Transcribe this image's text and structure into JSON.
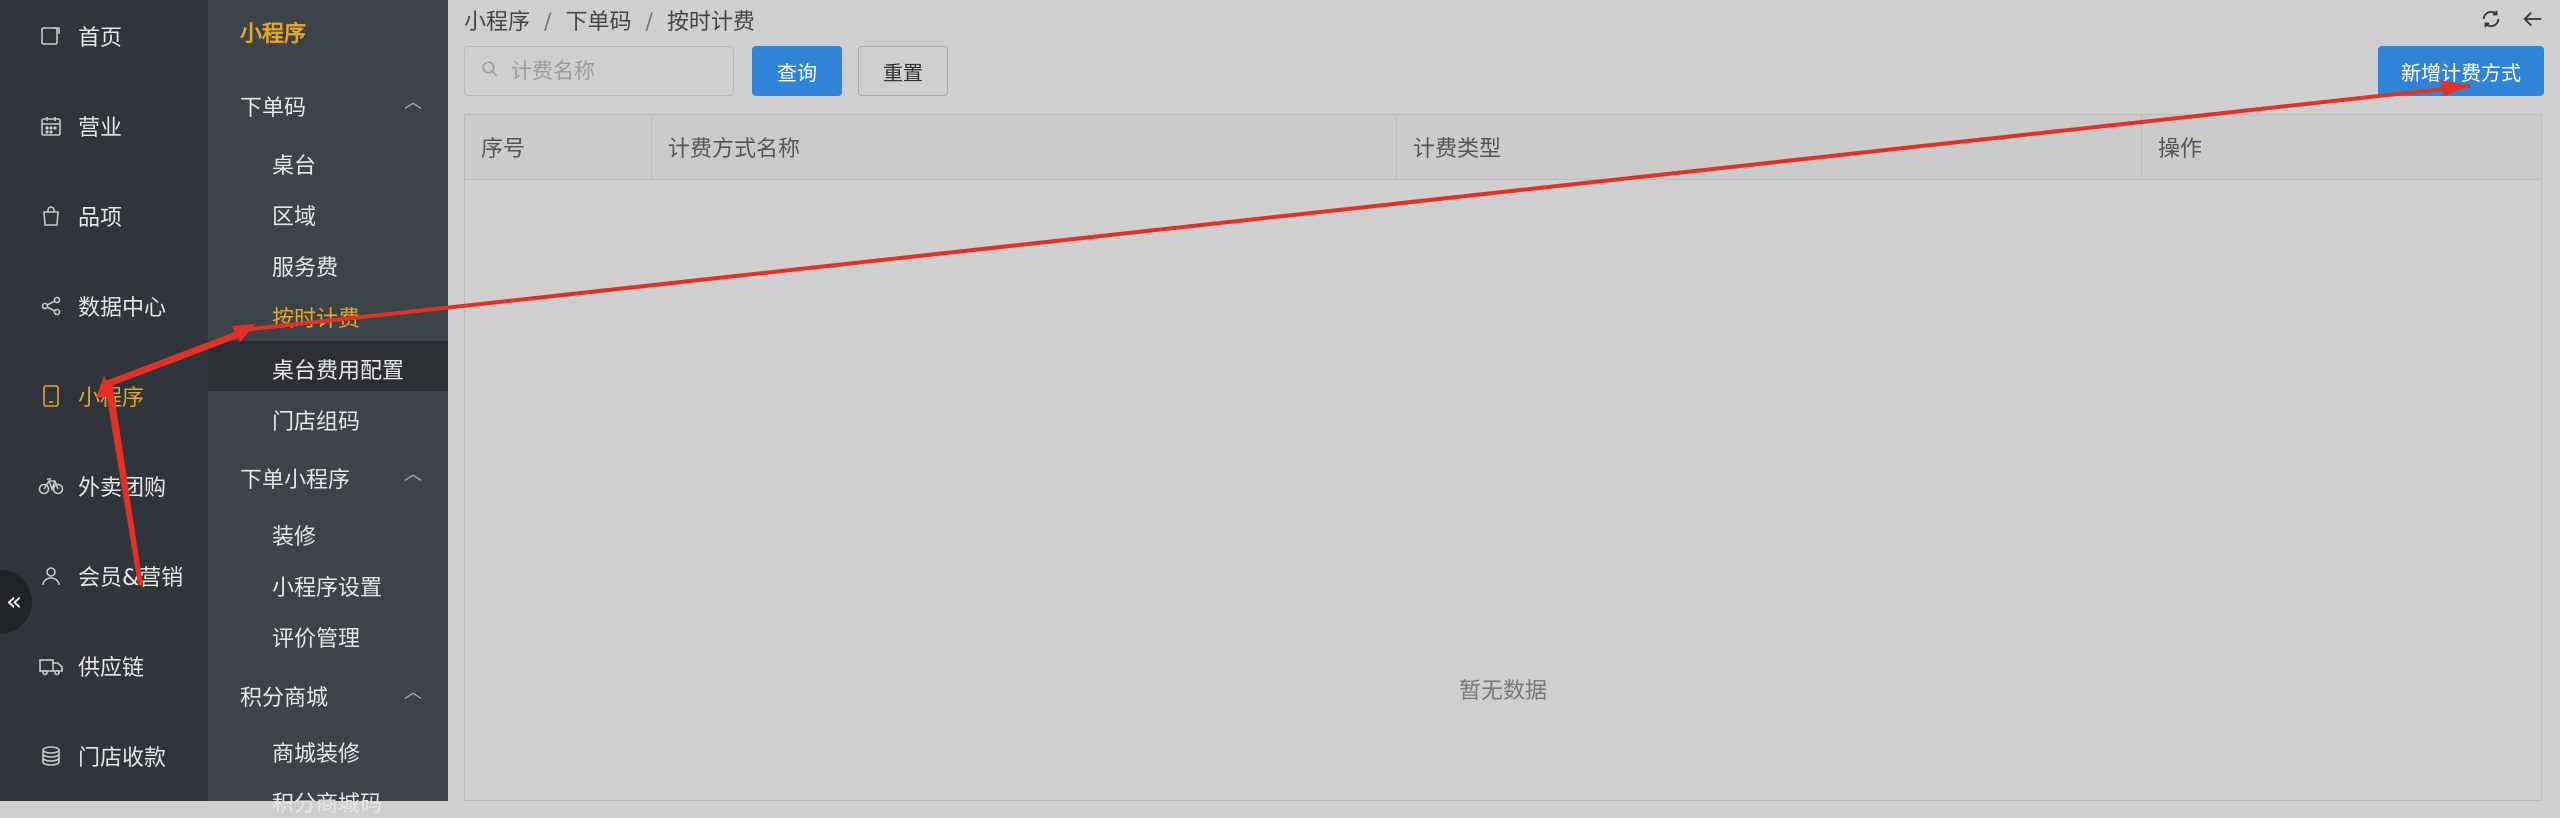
{
  "sidebar": {
    "items": [
      {
        "label": "首页",
        "icon": "home-icon"
      },
      {
        "label": "营业",
        "icon": "calendar-icon"
      },
      {
        "label": "品项",
        "icon": "shopping-bag-icon"
      },
      {
        "label": "数据中心",
        "icon": "share-icon"
      },
      {
        "label": "小程序",
        "icon": "tablet-icon",
        "active": true
      },
      {
        "label": "外卖团购",
        "icon": "bicycle-icon"
      },
      {
        "label": "会员&营销",
        "icon": "user-icon"
      },
      {
        "label": "供应链",
        "icon": "truck-icon"
      },
      {
        "label": "门店收款",
        "icon": "coins-icon"
      }
    ],
    "collapse_icon": "double-chevron-left-icon"
  },
  "subnav": {
    "title": "小程序",
    "groups": [
      {
        "label": "下单码",
        "items": [
          "桌台",
          "区域",
          "服务费",
          "按时计费",
          "桌台费用配置",
          "门店组码"
        ]
      },
      {
        "label": "下单小程序",
        "items": [
          "装修",
          "小程序设置",
          "评价管理"
        ]
      },
      {
        "label": "积分商城",
        "items": [
          "商城装修",
          "积分商城码"
        ]
      }
    ],
    "active_item": "按时计费"
  },
  "breadcrumb": [
    "小程序",
    "下单码",
    "按时计费"
  ],
  "breadcrumb_sep": "/",
  "toolbar": {
    "search_placeholder": "计费名称",
    "search_value": "",
    "query_label": "查询",
    "reset_label": "重置",
    "add_label": "新增计费方式"
  },
  "top_icons": [
    "refresh-icon",
    "arrow-left-icon"
  ],
  "table": {
    "columns": [
      "序号",
      "计费方式名称",
      "计费类型",
      "操作"
    ],
    "rows": [],
    "empty_text": "暂无数据"
  },
  "colors": {
    "accent": "#e5a72b",
    "primary": "#2f84d8",
    "annotation": "#e53025"
  }
}
